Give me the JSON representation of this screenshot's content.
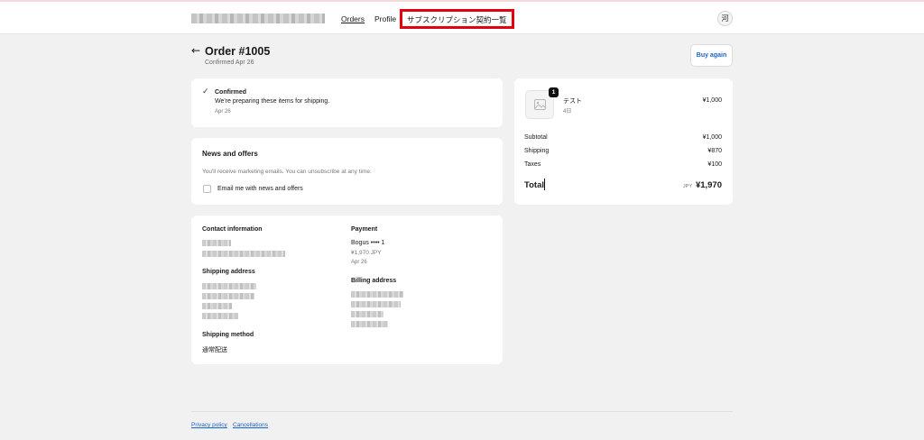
{
  "header": {
    "nav_orders": "Orders",
    "nav_profile": "Profile",
    "nav_subscriptions": "サブスクリプション契約一覧",
    "avatar_initial": "河"
  },
  "order": {
    "back_icon": "arrow-left-icon",
    "title": "Order #1005",
    "subtitle": "Confirmed Apr 26",
    "buy_again": "Buy again"
  },
  "status": {
    "icon": "checkmark-icon",
    "title": "Confirmed",
    "message": "We're preparing these items for shipping.",
    "date": "Apr 26"
  },
  "news": {
    "title": "News and offers",
    "description": "You'll receive marketing emails. You can unsubscribe at any time.",
    "checkbox_label": "Email me with news and offers",
    "checked": false
  },
  "info": {
    "contact_heading": "Contact information",
    "shipping_address_heading": "Shipping address",
    "shipping_method_heading": "Shipping method",
    "shipping_method": "通常配送",
    "payment_heading": "Payment",
    "payment_method": "Bogus •••• 1",
    "payment_amount": "¥1,970 JPY",
    "payment_date": "Apr 26",
    "billing_address_heading": "Billing address"
  },
  "summary": {
    "item": {
      "quantity": "1",
      "name": "テスト",
      "variant": "4日",
      "price": "¥1,000",
      "image_icon": "image-placeholder-icon"
    },
    "subtotal_label": "Subtotal",
    "subtotal": "¥1,000",
    "shipping_label": "Shipping",
    "shipping": "¥870",
    "taxes_label": "Taxes",
    "taxes": "¥100",
    "total_label": "Total",
    "currency": "JPY",
    "total": "¥1,970"
  },
  "footer": {
    "privacy": "Privacy policy",
    "cancellations": "Cancellations"
  }
}
